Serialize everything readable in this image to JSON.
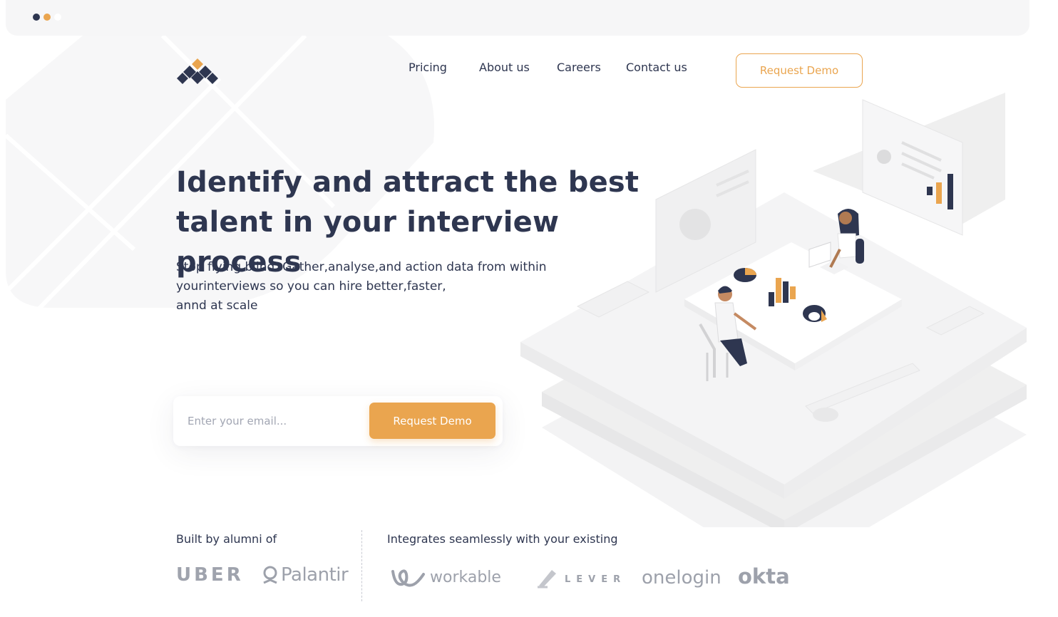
{
  "colors": {
    "navy": "#2e3650",
    "accent": "#eaa54f",
    "logo_gray": "#9da1ab",
    "bg_light": "#f6f6f7"
  },
  "window": {
    "dots": [
      "navy-dot",
      "orange-dot",
      "white-dot"
    ]
  },
  "brand": {
    "logo_icon": "diamond-cluster-logo"
  },
  "nav": {
    "items": [
      {
        "label": "Pricing"
      },
      {
        "label": "About us"
      },
      {
        "label": "Careers"
      },
      {
        "label": "Contact us"
      }
    ],
    "cta_label": "Request Demo"
  },
  "hero": {
    "title_line1": "Identify and attract the best",
    "title_line2": "talent in your interview process",
    "sub_line1": "Stop flying blind  Gather,analyse,and action data from within",
    "sub_line2": "yourinterviews so you can hire better,faster,",
    "sub_line3": "annd at scale"
  },
  "signup": {
    "email_placeholder": "Enter your email...",
    "email_value": "",
    "button_label": "Request Demo"
  },
  "footer": {
    "alumni_label": "Built by alumni of",
    "integrations_label": "Integrates seamlessly with your existing",
    "alumni_logos": [
      "UBER",
      "Palantir"
    ],
    "integration_logos": [
      "workable",
      "LEVER",
      "onelogin",
      "okta"
    ]
  }
}
